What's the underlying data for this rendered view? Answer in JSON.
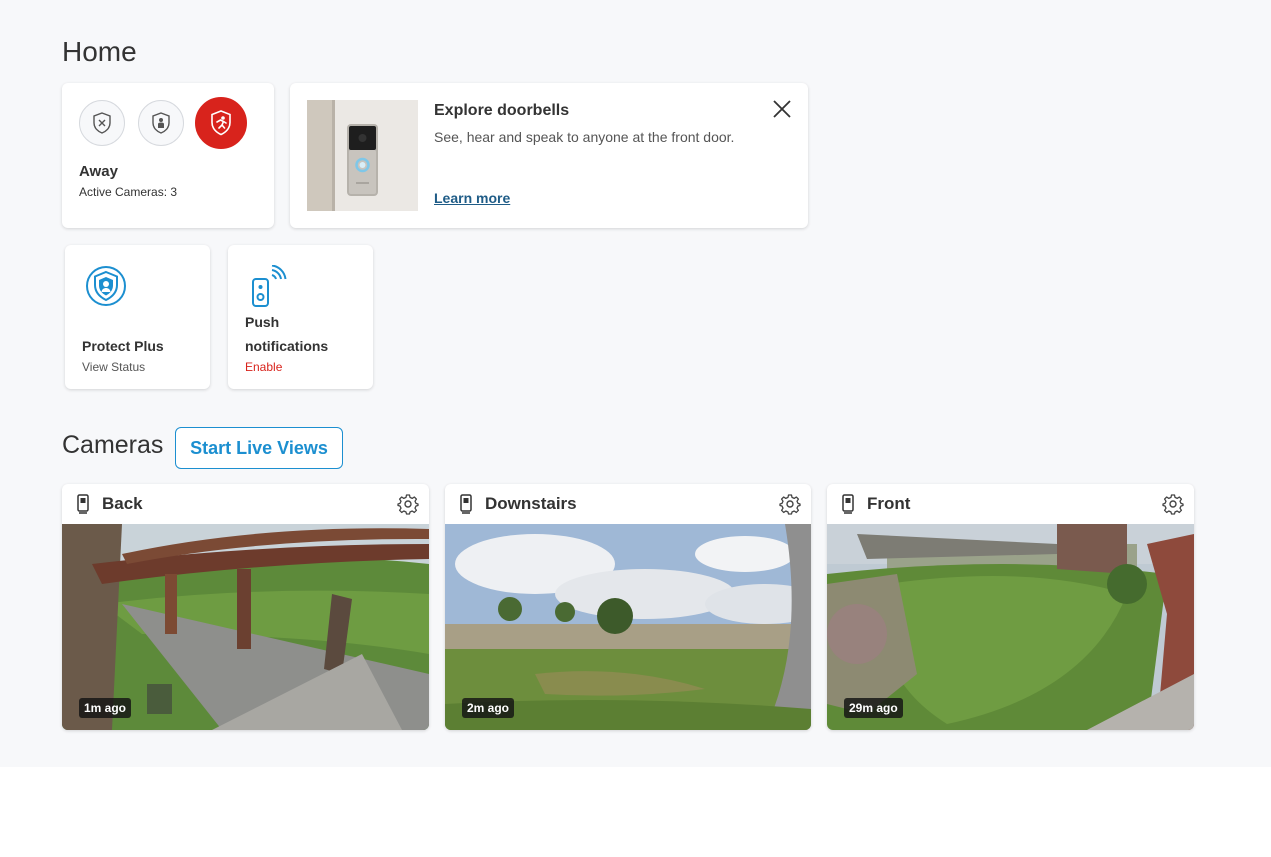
{
  "page": {
    "title": "Home"
  },
  "mode": {
    "buttons": [
      {
        "name": "disarmed",
        "icon": "shield-x-icon"
      },
      {
        "name": "home",
        "icon": "shield-person-icon"
      },
      {
        "name": "away",
        "icon": "shield-running-icon",
        "active": true
      }
    ],
    "label": "Away",
    "status": "Active Cameras: 3",
    "active_color": "#d8231c"
  },
  "promo": {
    "title": "Explore doorbells",
    "description": "See, hear and speak to anyone at the front door.",
    "link": "Learn more",
    "close_icon": "close-icon",
    "image_icon": "doorbell-icon"
  },
  "tiles": {
    "protect": {
      "icon": "protect-plus-shield-icon",
      "title": "Protect Plus",
      "sub": "View Status",
      "sub_color": "#555555"
    },
    "push": {
      "icon": "doorbell-wifi-icon",
      "title_line1": "Push",
      "title_line2": "notifications",
      "sub": "Enable",
      "sub_color": "#d8231c"
    }
  },
  "cameras": {
    "heading": "Cameras",
    "live_button": "Start Live Views",
    "accent": "#1c8fd0",
    "items": [
      {
        "name": "Back",
        "time": "1m ago",
        "icon": "camera-device-icon",
        "settings_icon": "gear-icon"
      },
      {
        "name": "Downstairs",
        "time": "2m ago",
        "icon": "camera-device-icon",
        "settings_icon": "gear-icon"
      },
      {
        "name": "Front",
        "time": "29m ago",
        "icon": "camera-device-icon",
        "settings_icon": "gear-icon"
      }
    ]
  }
}
